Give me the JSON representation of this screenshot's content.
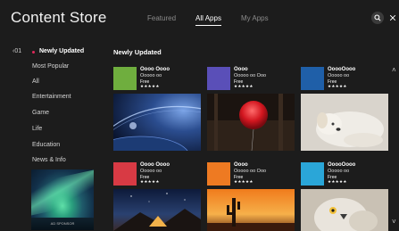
{
  "header": {
    "title": "Content Store",
    "tabs": [
      {
        "label": "Featured",
        "active": false
      },
      {
        "label": "All Apps",
        "active": true
      },
      {
        "label": "My Apps",
        "active": false
      }
    ],
    "search_icon": "search-icon",
    "close_icon": "close-icon"
  },
  "sidebar": {
    "page_indicator": "‹01",
    "items": [
      {
        "label": "Newly Updated",
        "active": true
      },
      {
        "label": "Most Popular"
      },
      {
        "label": "All"
      },
      {
        "label": "Entertainment"
      },
      {
        "label": "Game"
      },
      {
        "label": "Life"
      },
      {
        "label": "Education"
      },
      {
        "label": "News & Info"
      }
    ],
    "preview_caption": "AD SPONSOR"
  },
  "main": {
    "section_title": "Newly Updated",
    "cards": [
      {
        "name": "Oooo Oooo",
        "sub": "Ooooo oo",
        "price": "Free",
        "stars": "★★★★★",
        "icon_color": "#6fae3e"
      },
      {
        "name": "Oooo",
        "sub": "Ooooo oo Ooo",
        "price": "Free",
        "stars": "★★★★★",
        "icon_color": "#5a4fb8"
      },
      {
        "name": "OoooOooo",
        "sub": "Ooooo oo",
        "price": "Free",
        "stars": "★★★★★",
        "icon_color": "#1f5fa8"
      },
      {
        "name": "Oooo Oooo",
        "sub": "Ooooo oo",
        "price": "Free",
        "stars": "★★★★★",
        "icon_color": "#d83a44"
      },
      {
        "name": "Oooo",
        "sub": "Ooooo oo Ooo",
        "price": "Free",
        "stars": "★★★★★",
        "icon_color": "#ee7a22"
      },
      {
        "name": "OoooOooo",
        "sub": "Ooooo oo",
        "price": "Free",
        "stars": "★★★★★",
        "icon_color": "#2aa6d8"
      }
    ]
  },
  "scroll": {
    "up": "˄",
    "down": "˅"
  }
}
